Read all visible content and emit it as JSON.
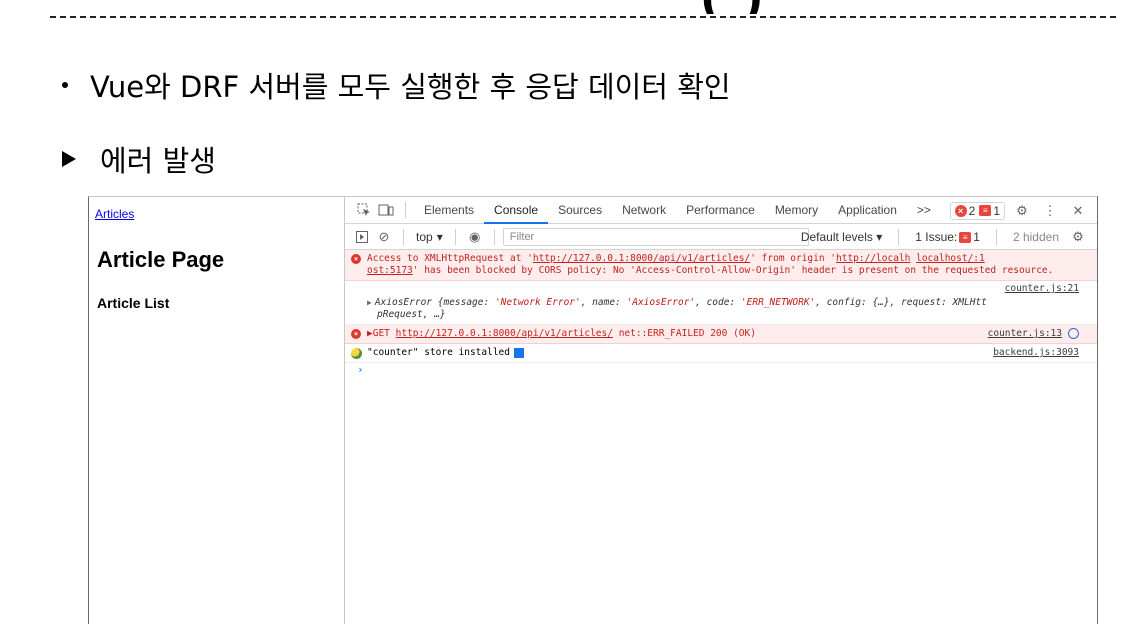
{
  "slide": {
    "title_fragment": "(    )",
    "bullet_text": "Vue와 DRF 서버를 모두 실행한 후 응답 데이터 확인",
    "subpoint_text": "에러 발생"
  },
  "page": {
    "nav_link": "Articles",
    "heading": "Article Page",
    "subheading": "Article List"
  },
  "devtools": {
    "tabs": [
      "Elements",
      "Console",
      "Sources",
      "Network",
      "Performance",
      "Memory",
      "Application"
    ],
    "active_tab": "Console",
    "more_tabs": ">>",
    "error_count": "2",
    "issue_count": "1",
    "toolbar": {
      "context": "top",
      "filter_placeholder": "Filter",
      "levels": "Default levels",
      "issues_label": "1 Issue:",
      "issues_count": "1",
      "hidden": "2 hidden"
    },
    "messages": {
      "cors_prefix": "Access to XMLHttpRequest at '",
      "cors_url": "http://127.0.0.1:8000/api/v1/articles/",
      "cors_mid": "' from origin '",
      "cors_origin_a": "http://localh",
      "cors_origin_b": "localhost/:1",
      "cors_origin_c": "ost:5173",
      "cors_rest": "' has been blocked by CORS policy: No 'Access-Control-Allow-Origin' header is present on the requested resource.",
      "axios_src": "counter.js:21",
      "axios_line1_a": "AxiosError {message: ",
      "axios_msg": "'Network Error'",
      "axios_name_k": ", name: ",
      "axios_name": "'AxiosError'",
      "axios_code_k": ", code: ",
      "axios_code": "'ERR_NETWORK'",
      "axios_tail": ", config: {…}, request: XMLHtt",
      "axios_line2": "pRequest, …}",
      "get_method": "▶GET",
      "get_url": "http://127.0.0.1:8000/api/v1/articles/",
      "get_status": "net::ERR_FAILED 200 (OK)",
      "get_src": "counter.js:13",
      "store_text": "\"counter\" store installed",
      "store_src": "backend.js:3093"
    }
  }
}
